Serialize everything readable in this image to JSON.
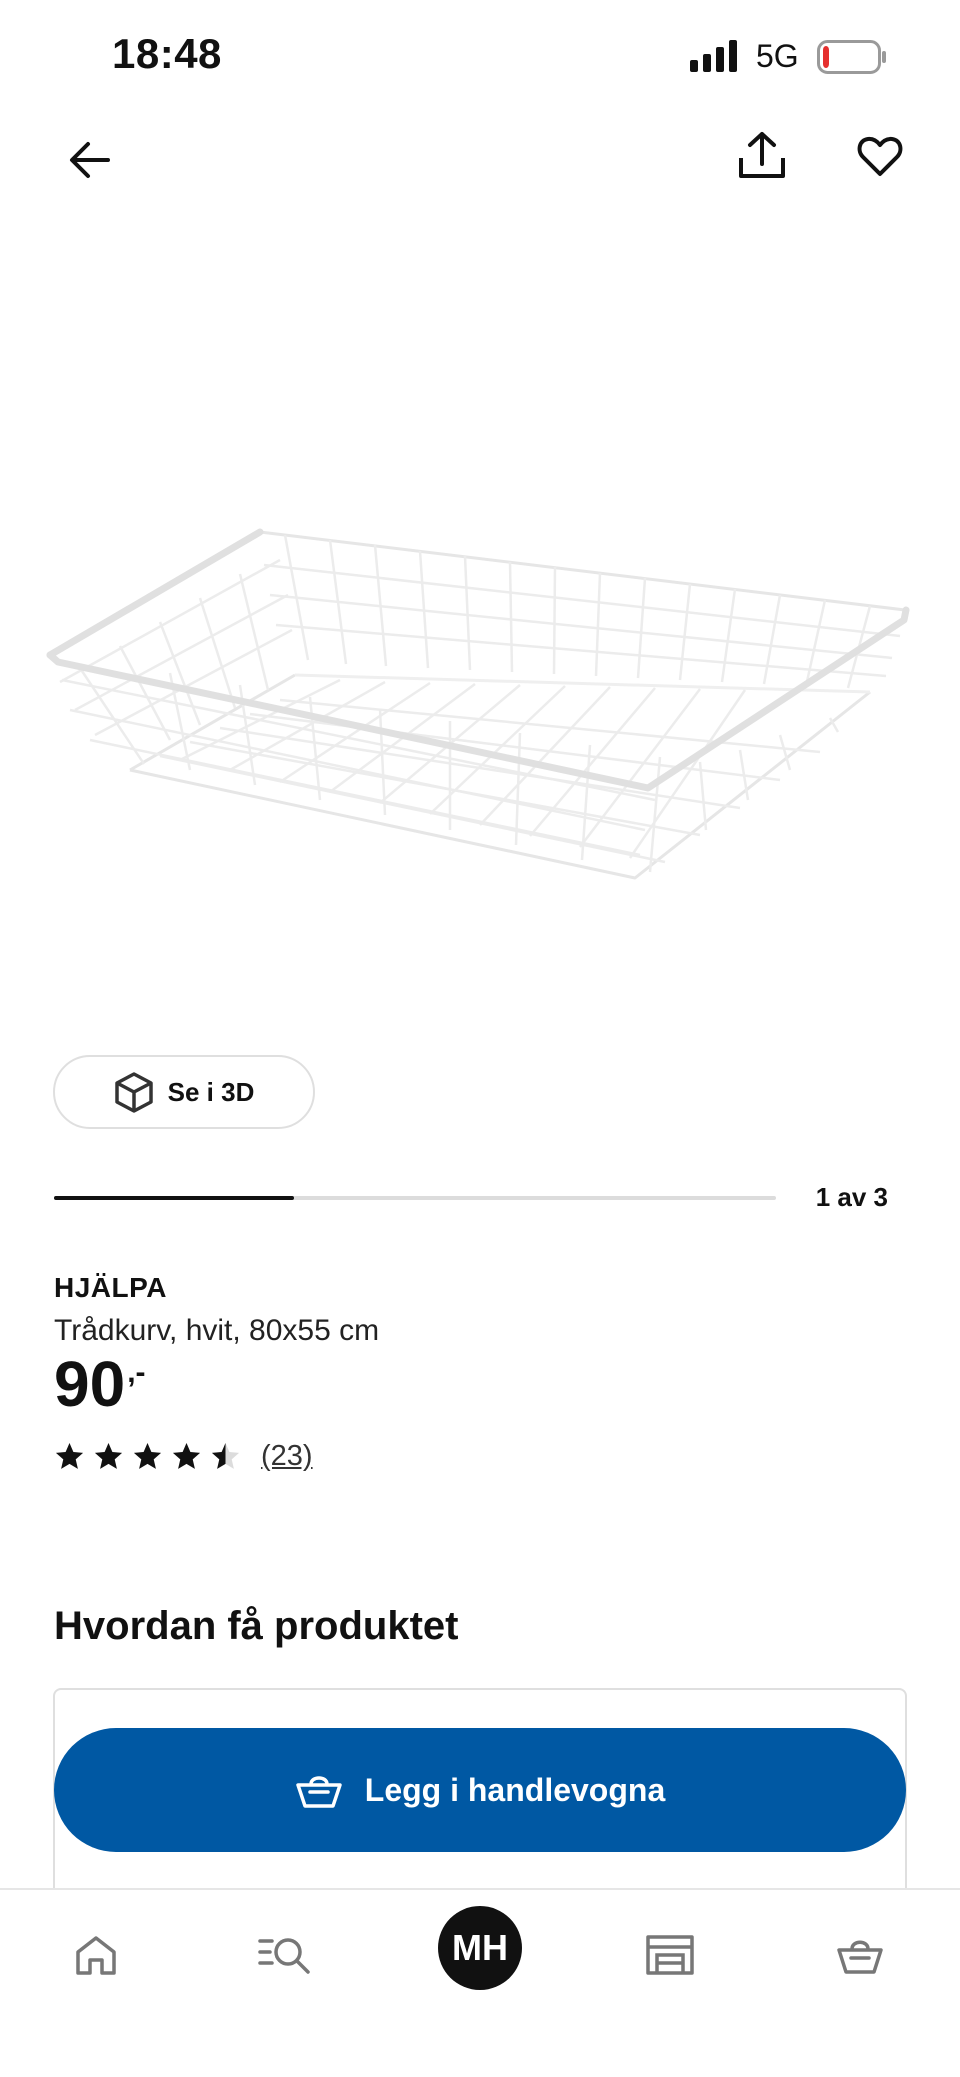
{
  "status": {
    "time": "18:48",
    "network": "5G",
    "battery_level": 0.1,
    "battery_color": "#e5302f"
  },
  "topnav": {
    "back_icon": "arrow-left-icon",
    "share_icon": "share-icon",
    "favorite_icon": "heart-icon"
  },
  "gallery": {
    "view3d_label": "Se i 3D",
    "view3d_icon": "cube-icon",
    "current": 1,
    "total": 3,
    "progress_text": "1 av 3",
    "progress_fraction": 0.333
  },
  "product": {
    "name": "HJÄLPA",
    "description": "Trådkurv, hvit, 80x55 cm",
    "price_integer": "90",
    "price_decimal": ",-",
    "rating": 4.5,
    "rating_max": 5,
    "review_count": "(23)"
  },
  "delivery": {
    "section_title": "Hvordan få produktet",
    "cart_button_label": "Legg i handlevogna",
    "cart_button_color": "#0058a3"
  },
  "bottom_nav": {
    "items": [
      {
        "icon": "home-icon"
      },
      {
        "icon": "search-list-icon"
      },
      {
        "avatar": "MH"
      },
      {
        "icon": "store-icon"
      },
      {
        "icon": "basket-icon"
      }
    ]
  }
}
